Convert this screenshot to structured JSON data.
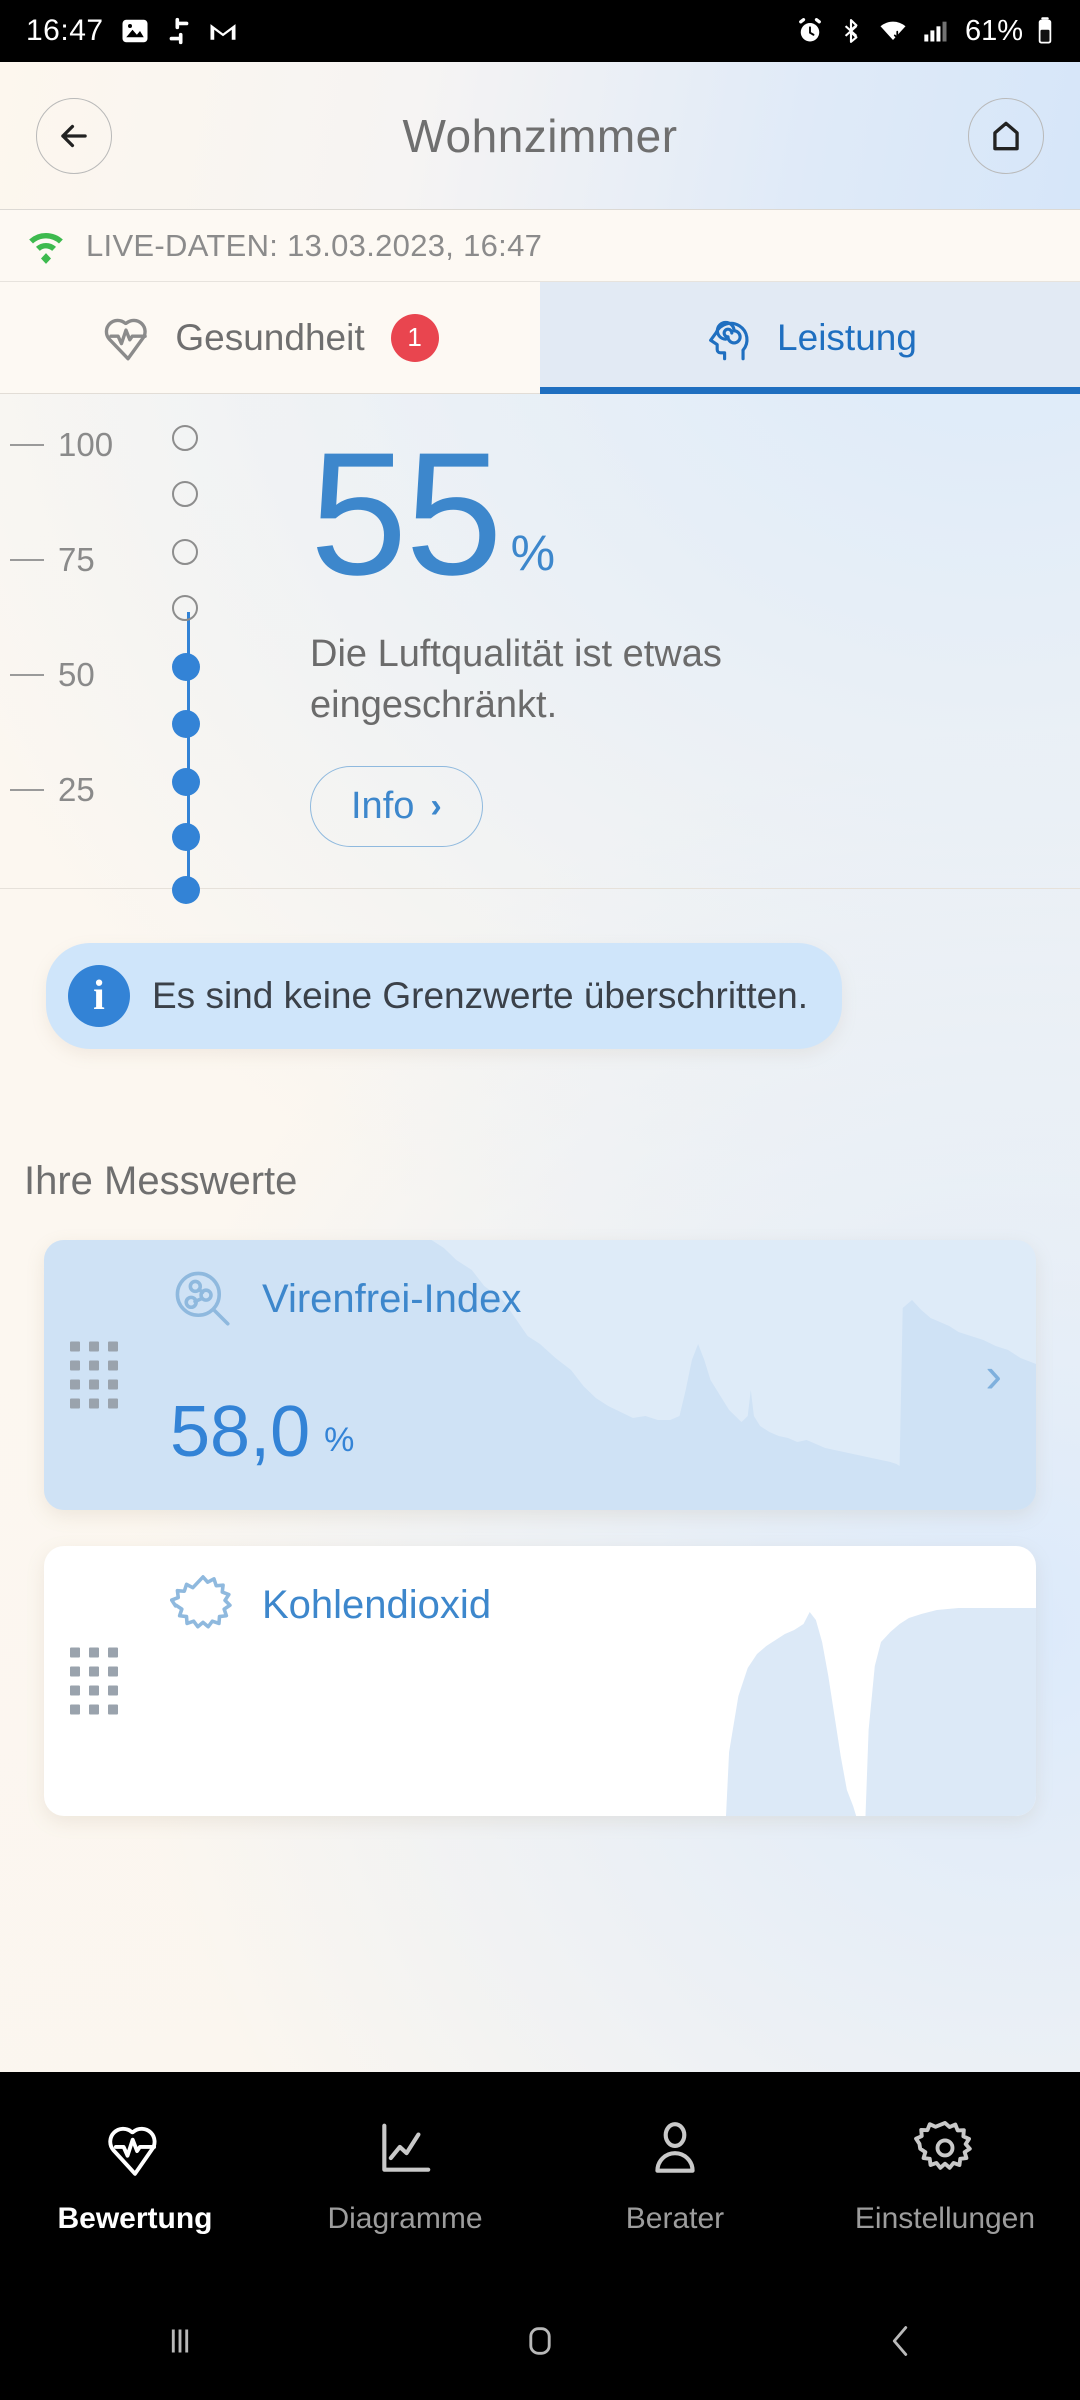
{
  "status_bar": {
    "time": "16:47",
    "battery_percent": "61%",
    "left_icons": [
      "photo-icon",
      "slack-icon",
      "gmail-icon"
    ],
    "right_icons": [
      "alarm-icon",
      "bluetooth-icon",
      "wifi-icon",
      "signal-icon",
      "battery-icon"
    ]
  },
  "header": {
    "title": "Wohnzimmer",
    "back_icon": "arrow-left-icon",
    "home_icon": "home-icon"
  },
  "live_bar": {
    "icon": "wifi-live-icon",
    "text": "LIVE-DATEN: 13.03.2023, 16:47",
    "accent": "#3dba4e"
  },
  "tabs": [
    {
      "label": "Gesundheit",
      "icon": "heart-pulse-icon",
      "active": false,
      "badge": "1"
    },
    {
      "label": "Leistung",
      "icon": "head-spiral-icon",
      "active": true,
      "badge": ""
    }
  ],
  "gauge": {
    "value": "55",
    "unit": "%",
    "description": "Die Luftqualität ist etwas eingeschränkt.",
    "info_label": "Info",
    "info_chevron": "›",
    "accent": "#3d87cc",
    "scale_labels": [
      "100",
      "75",
      "50",
      "25"
    ]
  },
  "banner": {
    "icon": "info-icon",
    "text": "Es sind keine Grenzwerte überschritten.",
    "bg": "#cfe5fa",
    "icon_bg": "#3383d6"
  },
  "measurements": {
    "section_title": "Ihre Messwerte",
    "cards": [
      {
        "title": "Virenfrei-Index",
        "icon": "molecule-search-icon",
        "value": "58,0",
        "unit": "%",
        "chevron": "›",
        "drag_handle": "drag-handle-icon",
        "tinted": true
      },
      {
        "title": "Kohlendioxid",
        "icon": "burst-icon",
        "value": "",
        "unit": "",
        "chevron": "",
        "drag_handle": "drag-handle-icon",
        "tinted": false
      }
    ]
  },
  "bottom_nav": [
    {
      "label": "Bewertung",
      "icon": "heart-pulse-icon",
      "active": true
    },
    {
      "label": "Diagramme",
      "icon": "line-chart-icon",
      "active": false
    },
    {
      "label": "Berater",
      "icon": "person-icon",
      "active": false
    },
    {
      "label": "Einstellungen",
      "icon": "gear-icon",
      "active": false
    }
  ],
  "system_nav": [
    {
      "icon": "recents-icon"
    },
    {
      "icon": "home-square-icon"
    },
    {
      "icon": "back-chevron-icon"
    }
  ],
  "chart_data": [
    {
      "type": "area",
      "title": "Virenfrei-Index",
      "ylabel": "%",
      "current_value": 58.0,
      "ylim": [
        0,
        100
      ],
      "values": [
        100,
        100,
        100,
        100,
        100,
        100,
        100,
        100,
        100,
        100,
        100,
        100,
        100,
        100,
        98,
        96,
        94,
        90,
        84,
        80,
        76,
        70,
        64,
        58,
        54,
        50,
        44,
        40,
        36,
        33,
        31,
        30,
        30,
        29,
        29,
        28,
        29,
        30,
        31,
        33,
        46,
        58,
        72,
        64,
        56,
        50,
        46,
        44,
        52,
        41,
        34,
        30,
        57,
        28,
        26,
        25,
        24,
        22,
        21,
        20,
        19,
        19,
        18,
        17,
        17,
        16,
        15,
        15,
        14,
        14,
        13,
        12,
        12,
        11,
        11,
        10,
        10,
        9,
        9,
        8,
        8,
        7,
        7,
        6,
        6,
        5,
        5,
        86,
        92,
        88,
        84,
        83,
        81,
        80,
        79,
        78,
        77,
        76,
        75,
        74
      ]
    },
    {
      "type": "area",
      "title": "Kohlendioxid",
      "ylim": [
        0,
        100
      ],
      "values": [
        0,
        0,
        0,
        0,
        0,
        0,
        0,
        0,
        0,
        0,
        0,
        0,
        0,
        0,
        0,
        0,
        0,
        0,
        0,
        0,
        0,
        0,
        0,
        0,
        0,
        0,
        0,
        0,
        0,
        0,
        0,
        0,
        0,
        0,
        0,
        0,
        0,
        0,
        0,
        0,
        0,
        0,
        0,
        0,
        0,
        0,
        0,
        0,
        0,
        0,
        0,
        0,
        0,
        0,
        0,
        0,
        0,
        0,
        0,
        0,
        0,
        0,
        0,
        10,
        40,
        56,
        62,
        66,
        70,
        74,
        78,
        80,
        82,
        84,
        80,
        62,
        40,
        20,
        10,
        8,
        30,
        60,
        72,
        62,
        70,
        84,
        88,
        90,
        91,
        92,
        93,
        93,
        94,
        94,
        95,
        95,
        95,
        95,
        95,
        95
      ]
    }
  ],
  "gauge_chart": {
    "type": "scatter",
    "ylim": [
      0,
      110
    ],
    "ticks": [
      100,
      75,
      50,
      25
    ],
    "dots": [
      {
        "y": 103,
        "filled": false
      },
      {
        "y": 88,
        "filled": false
      },
      {
        "y": 73,
        "filled": false
      },
      {
        "y": 61,
        "filled": false
      },
      {
        "y": 50,
        "filled": true
      },
      {
        "y": 38,
        "filled": true
      },
      {
        "y": 27,
        "filled": true
      },
      {
        "y": 16,
        "filled": true
      },
      {
        "y": 4,
        "filled": true
      }
    ]
  }
}
